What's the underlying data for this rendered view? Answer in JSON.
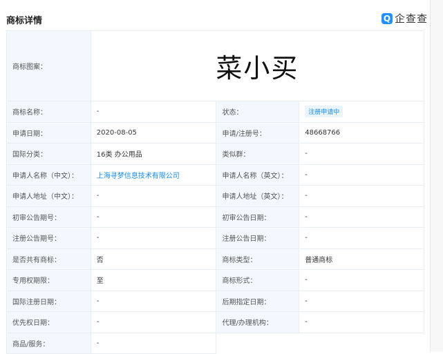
{
  "header": {
    "title": "商标详情",
    "logo_text": "企查查",
    "logo_mark": "Q"
  },
  "trademark_image": {
    "label": "商标图案：",
    "text": "菜小买"
  },
  "rows": [
    {
      "l1": "商标名称：",
      "v1": "-",
      "l2": "状态：",
      "v2": "注册申请中"
    },
    {
      "l1": "申请日期：",
      "v1": "2020-08-05",
      "l2": "申请/注册号：",
      "v2": "48668766"
    },
    {
      "l1": "国际分类：",
      "v1": "16类 办公用品",
      "l2": "类似群：",
      "v2": "-"
    },
    {
      "l1": "申请人名称（中文）：",
      "v1": "上海寻梦信息技术有限公司",
      "l2": "申请人名称（英文）：",
      "v2": "-"
    },
    {
      "l1": "申请人地址（中文）：",
      "v1": "-",
      "l2": "申请人地址（英文）：",
      "v2": "-"
    },
    {
      "l1": "初审公告期号：",
      "v1": "-",
      "l2": "初审公告日期：",
      "v2": "-"
    },
    {
      "l1": "注册公告期号：",
      "v1": "-",
      "l2": "注册公告日期：",
      "v2": "-"
    },
    {
      "l1": "是否共有商标：",
      "v1": "否",
      "l2": "商标类型：",
      "v2": "普通商标"
    },
    {
      "l1": "专用权期限：",
      "v1": "至",
      "l2": "商标形式：",
      "v2": "-"
    },
    {
      "l1": "国际注册日期：",
      "v1": "-",
      "l2": "后期指定日期：",
      "v2": "-"
    },
    {
      "l1": "优先权日期：",
      "v1": "-",
      "l2": "代理/办理机构：",
      "v2": "-"
    }
  ],
  "goods": {
    "label": "商品/服务：",
    "value": "-"
  }
}
